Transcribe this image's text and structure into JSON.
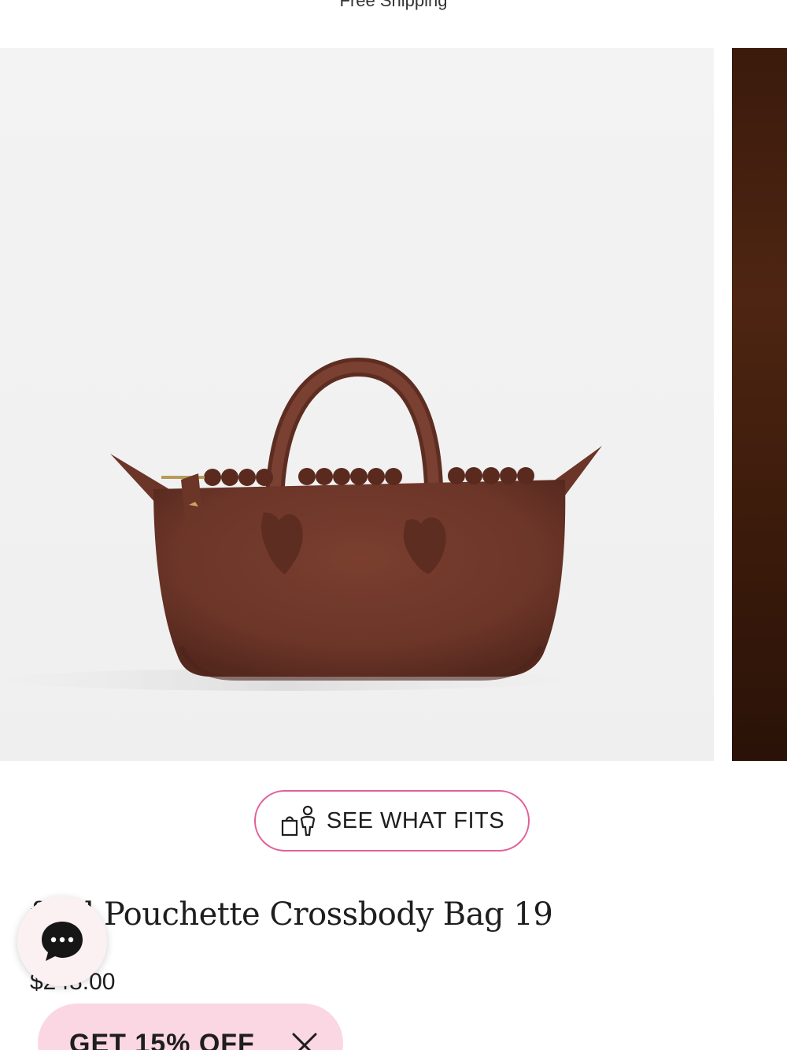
{
  "header": {
    "cut_text": "Free Shipping"
  },
  "fit_button": {
    "label": "SEE WHAT FITS",
    "border_color": "#e0609a"
  },
  "product": {
    "title": "ford Pouchette Crossbody Bag 19",
    "price": "$248.00"
  },
  "promo": {
    "label": "GET 15% OFF",
    "background": "#fbd7e3"
  },
  "colors": {
    "bag": "#6b3528",
    "accent_pink": "#e0609a"
  },
  "icons": {
    "fit": "bag-person-icon",
    "chat": "chat-icon",
    "close": "close-icon"
  }
}
